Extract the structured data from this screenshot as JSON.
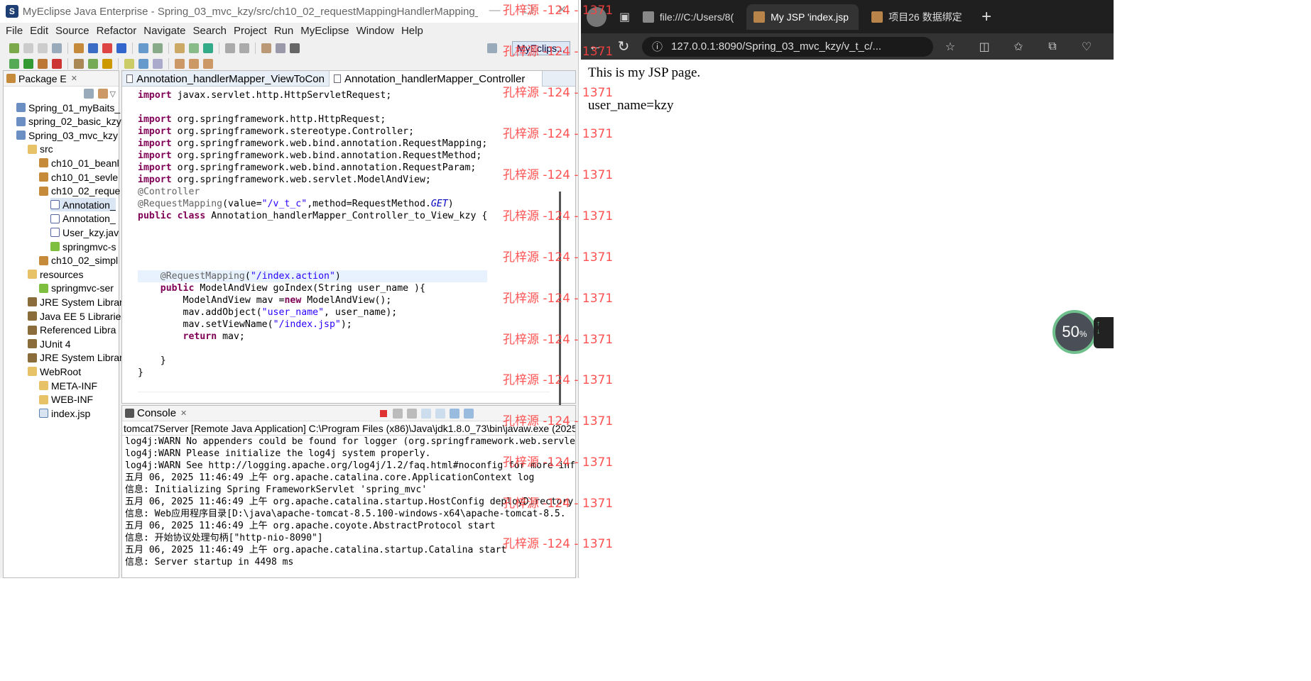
{
  "ide": {
    "title": "MyEclipse Java Enterprise - Spring_03_mvc_kzy/src/ch10_02_requestMappingHandlerMapping_kzy/Annotation_...",
    "menu": [
      "File",
      "Edit",
      "Source",
      "Refactor",
      "Navigate",
      "Search",
      "Project",
      "Run",
      "MyEclipse",
      "Window",
      "Help"
    ],
    "perspective": "MyEclips...",
    "package_explorer": {
      "tab": "Package E",
      "tree": [
        {
          "label": "Spring_01_myBaits_",
          "icon": "project-icon",
          "level": 0
        },
        {
          "label": "spring_02_basic_kzy",
          "icon": "project-icon",
          "level": 0
        },
        {
          "label": "Spring_03_mvc_kzy",
          "icon": "project-icon",
          "level": 0
        },
        {
          "label": "src",
          "icon": "source-folder-icon",
          "level": 1
        },
        {
          "label": "ch10_01_beanl",
          "icon": "package-icon",
          "level": 2
        },
        {
          "label": "ch10_01_sevle",
          "icon": "package-icon",
          "level": 2
        },
        {
          "label": "ch10_02_reque",
          "icon": "package-icon",
          "level": 2
        },
        {
          "label": "Annotation_",
          "icon": "java-file-icon",
          "level": 3,
          "selected": true
        },
        {
          "label": "Annotation_",
          "icon": "java-file-icon",
          "level": 3
        },
        {
          "label": "User_kzy.jav",
          "icon": "java-file-icon",
          "level": 3
        },
        {
          "label": "springmvc-s",
          "icon": "xml-file-icon",
          "level": 3
        },
        {
          "label": "ch10_02_simpl",
          "icon": "package-icon",
          "level": 2
        },
        {
          "label": "resources",
          "icon": "source-folder-icon",
          "level": 1
        },
        {
          "label": "springmvc-ser",
          "icon": "xml-file-icon",
          "level": 2
        },
        {
          "label": "JRE System Librar",
          "icon": "library-icon",
          "level": 1
        },
        {
          "label": "Java EE 5 Libraries",
          "icon": "library-icon",
          "level": 1
        },
        {
          "label": "Referenced Libra",
          "icon": "library-icon",
          "level": 1
        },
        {
          "label": "JUnit 4",
          "icon": "library-icon",
          "level": 1
        },
        {
          "label": "JRE System Librar",
          "icon": "library-icon",
          "level": 1
        },
        {
          "label": "WebRoot",
          "icon": "folder-icon",
          "level": 1
        },
        {
          "label": "META-INF",
          "icon": "folder-icon",
          "level": 2
        },
        {
          "label": "WEB-INF",
          "icon": "folder-icon",
          "level": 2
        },
        {
          "label": "index.jsp",
          "icon": "jsp-file-icon",
          "level": 2
        }
      ]
    },
    "editor": {
      "tabs": [
        "Annotation_handlerMapper_ViewToCon",
        "Annotation_handlerMapper_Controller"
      ],
      "lines": [
        [
          [
            "kw",
            "import"
          ],
          [
            "",
            "javax.servlet.http.HttpServletRequest;"
          ]
        ],
        [
          [
            "",
            ""
          ]
        ],
        [
          [
            "kw",
            "import"
          ],
          [
            "",
            "org.springframework.http.HttpRequest;"
          ]
        ],
        [
          [
            "kw",
            "import"
          ],
          [
            "",
            "org.springframework.stereotype.Controller;"
          ]
        ],
        [
          [
            "kw",
            "import"
          ],
          [
            "",
            "org.springframework.web.bind.annotation.RequestMapping;"
          ]
        ],
        [
          [
            "kw",
            "import"
          ],
          [
            "",
            "org.springframework.web.bind.annotation.RequestMethod;"
          ]
        ],
        [
          [
            "kw",
            "import"
          ],
          [
            "",
            "org.springframework.web.bind.annotation.RequestParam;"
          ]
        ],
        [
          [
            "kw",
            "import"
          ],
          [
            "",
            "org.springframework.web.servlet.ModelAndView;"
          ]
        ],
        [
          [
            "an",
            "@Controller"
          ]
        ],
        [
          [
            "an",
            "@RequestMapping"
          ],
          [
            "",
            "(value="
          ],
          [
            "st",
            "\"/v_t_c\""
          ],
          [
            "",
            ",method=RequestMethod."
          ],
          [
            "it",
            "GET"
          ],
          [
            "",
            ")"
          ]
        ],
        [
          [
            "kw",
            "public class"
          ],
          [
            "",
            "Annotation_handlerMapper_Controller_to_View_kzy {"
          ]
        ],
        [
          [
            "",
            ""
          ]
        ],
        [
          [
            "",
            ""
          ]
        ],
        [
          [
            "",
            ""
          ]
        ],
        [
          [
            "",
            ""
          ]
        ],
        [
          [
            "",
            "    "
          ],
          [
            "an",
            "@RequestMapping"
          ],
          [
            "",
            "("
          ],
          [
            "st",
            "\"/index.action\""
          ],
          [
            "",
            ")"
          ]
        ],
        [
          [
            "",
            "    "
          ],
          [
            "kw",
            "public"
          ],
          [
            "",
            "ModelAndView goIndex(String user_name ){"
          ]
        ],
        [
          [
            "",
            "        ModelAndView mav ="
          ],
          [
            "kw",
            "new"
          ],
          [
            "",
            "ModelAndView();"
          ]
        ],
        [
          [
            "",
            "        mav.addObject("
          ],
          [
            "st",
            "\"user_name\""
          ],
          [
            "",
            ", user_name);"
          ]
        ],
        [
          [
            "",
            "        mav.setViewName("
          ],
          [
            "st",
            "\"/index.jsp\""
          ],
          [
            "",
            ");"
          ]
        ],
        [
          [
            "",
            "        "
          ],
          [
            "kw",
            "return"
          ],
          [
            "",
            "mav;"
          ]
        ],
        [
          [
            "",
            ""
          ]
        ],
        [
          [
            "",
            "    }"
          ]
        ],
        [
          [
            "",
            "}"
          ]
        ]
      ]
    },
    "console": {
      "tab": "Console",
      "description": "tomcat7Server [Remote Java Application] C:\\Program Files (x86)\\Java\\jdk1.8.0_73\\bin\\javaw.exe (2025-",
      "lines": [
        "log4j:WARN No appenders could be found for logger (org.springframework.web.servle",
        "log4j:WARN Please initialize the log4j system properly.",
        "log4j:WARN See http://logging.apache.org/log4j/1.2/faq.html#noconfig for more inf",
        "五月 06, 2025 11:46:49 上午 org.apache.catalina.core.ApplicationContext log",
        "信息: Initializing Spring FrameworkServlet 'spring_mvc'",
        "五月 06, 2025 11:46:49 上午 org.apache.catalina.startup.HostConfig deployDirectory",
        "信息: Web应用程序目录[D:\\java\\apache-tomcat-8.5.100-windows-x64\\apache-tomcat-8.5.",
        "五月 06, 2025 11:46:49 上午 org.apache.coyote.AbstractProtocol start",
        "信息: 开始协议处理句柄[\"http-nio-8090\"]",
        "五月 06, 2025 11:46:49 上午 org.apache.catalina.startup.Catalina start",
        "信息: Server startup in 4498 ms"
      ]
    }
  },
  "browser": {
    "tabs": [
      {
        "label": "file:///C:/Users/8(",
        "active": false
      },
      {
        "label": "My JSP 'index.jsp",
        "active": true
      },
      {
        "label": "项目26 数据绑定",
        "active": false
      }
    ],
    "url": "127.0.0.1:8090/Spring_03_mvc_kzy/v_t_c/...",
    "page": {
      "line1": "This is my JSP page.",
      "line2": "user_name=kzy"
    },
    "gauge": {
      "percent": "50",
      "unit": "%"
    }
  },
  "watermark": "孔梓源 -124 - 1371"
}
